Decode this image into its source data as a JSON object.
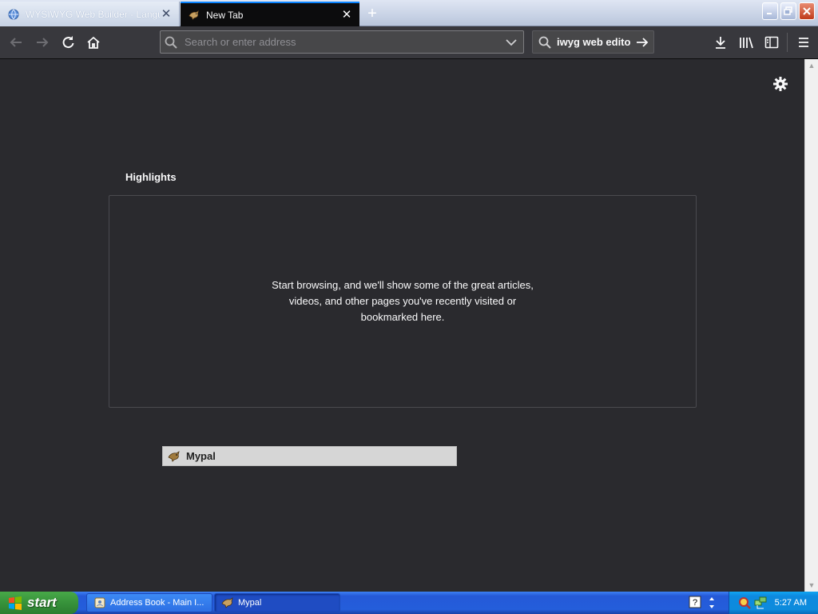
{
  "tabs": [
    {
      "title": "WYSIWYG Web Builder - Langua",
      "active": false
    },
    {
      "title": "New Tab",
      "active": true
    }
  ],
  "urlbar": {
    "placeholder": "Search or enter address",
    "value": ""
  },
  "searchbox": {
    "text": "iwyg web editor"
  },
  "content": {
    "section_title": "Highlights",
    "empty_message": "Start browsing, and we'll show some of the great articles, videos, and other pages you've recently visited or bookmarked here.",
    "tooltip": "Mypal"
  },
  "taskbar": {
    "start_label": "start",
    "items": [
      {
        "label": "Address Book - Main I...",
        "active": false
      },
      {
        "label": "Mypal",
        "active": true
      }
    ],
    "clock": "5:27 AM"
  },
  "colors": {
    "accent": "#0a84ff",
    "content_bg": "#2a2a2e",
    "toolbar_bg": "#38383d"
  }
}
